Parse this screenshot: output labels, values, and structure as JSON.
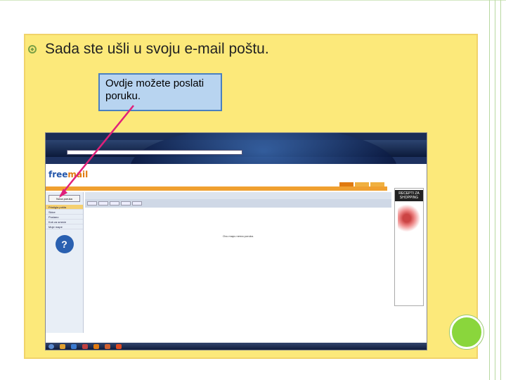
{
  "slide": {
    "bullet_text": "Sada ste ušli u svoju e-mail poštu.",
    "callout_text": "Ovdje možete poslati poruku."
  },
  "screenshot": {
    "logo_main": "free",
    "logo_accent": "mail",
    "compose_label": "Nova poruka",
    "folders": [
      "Pristigla pošta",
      "Skice",
      "Poslano",
      "Koš za smeće",
      "Moje mape"
    ],
    "empty_folder_text": "Ovu mapu nema poruka.",
    "help_glyph": "?",
    "ad_title": "RECEPTI ZA SHOPPING",
    "colors": {
      "slide_bg": "#fce97a",
      "callout_bg": "#b8d4f0",
      "arrow": "#e0207a",
      "accent_dot": "#8ad63c"
    }
  }
}
